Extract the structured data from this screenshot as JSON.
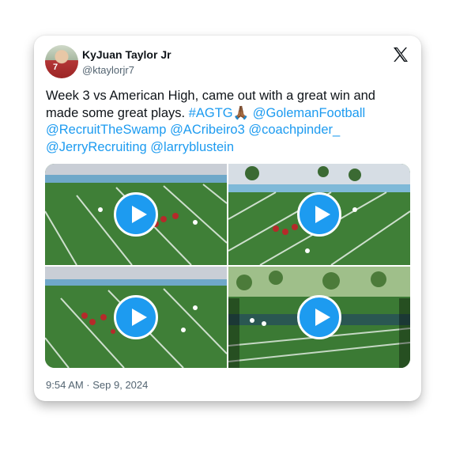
{
  "author": {
    "name": "KyJuan Taylor Jr",
    "handle": "@ktaylorjr7",
    "jersey_number": "7"
  },
  "tweet": {
    "text_plain": "Week 3 vs American High, came out with a great win and made some great plays.",
    "hashtag": "#AGTG",
    "emoji": "🙏🏾",
    "mentions": [
      "@GolemanFootball",
      "@RecruitTheSwamp",
      "@ACribeiro3",
      "@coachpinder_",
      "@JerryRecruiting",
      "@larryblustein"
    ]
  },
  "media": {
    "videos": [
      {
        "label": "video-1"
      },
      {
        "label": "video-2"
      },
      {
        "label": "video-3"
      },
      {
        "label": "video-4"
      }
    ],
    "play_icon": "play-icon"
  },
  "timestamp": "9:54 AM · Sep 9, 2024",
  "colors": {
    "link": "#1d9bf0",
    "text": "#0f1419",
    "muted": "#536471",
    "turf": "#3b7a34"
  }
}
